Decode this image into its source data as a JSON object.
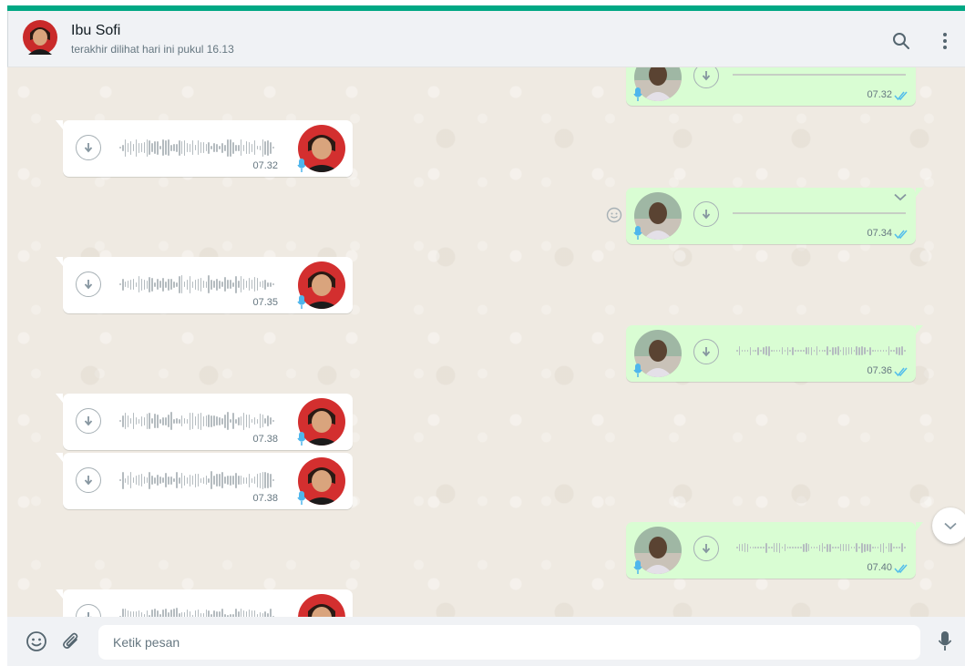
{
  "header": {
    "contact_name": "Ibu Sofi",
    "last_seen": "terakhir dilihat hari ini pukul 16.13",
    "icons": [
      "search-icon",
      "menu-icon"
    ]
  },
  "messages": [
    {
      "direction": "out",
      "time": "07.32",
      "status": "read",
      "waveform": "flat",
      "cropped_top": true
    },
    {
      "direction": "in",
      "time": "07.32",
      "waveform": "bars"
    },
    {
      "direction": "out",
      "time": "07.34",
      "status": "read",
      "waveform": "flat",
      "has_menu_chevron": true,
      "has_react_button": true
    },
    {
      "direction": "in",
      "time": "07.35",
      "waveform": "bars"
    },
    {
      "direction": "out",
      "time": "07.36",
      "status": "read",
      "waveform": "bars"
    },
    {
      "direction": "in",
      "time": "07.38",
      "waveform": "bars"
    },
    {
      "direction": "in",
      "time": "07.38",
      "waveform": "bars"
    },
    {
      "direction": "out",
      "time": "07.40",
      "status": "read",
      "waveform": "bars"
    },
    {
      "direction": "in",
      "time": "",
      "waveform": "bars",
      "cropped_bottom": true
    }
  ],
  "composer": {
    "placeholder": "Ketik pesan",
    "value": "",
    "icons": [
      "emoji-icon",
      "attach-icon",
      "mic-icon"
    ]
  },
  "colors": {
    "accent": "#00a884",
    "outgoing_bubble": "#d9fdd3",
    "incoming_bubble": "#ffffff",
    "read_ticks": "#53bdeb",
    "mic_badge": "#4fb6ec"
  }
}
